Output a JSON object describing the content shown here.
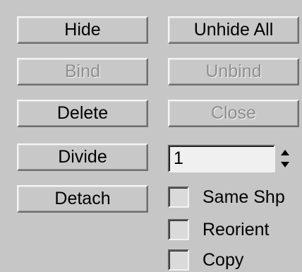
{
  "buttons": {
    "hide": "Hide",
    "unhide_all": "Unhide All",
    "bind": "Bind",
    "unbind": "Unbind",
    "delete": "Delete",
    "close": "Close",
    "divide": "Divide",
    "detach": "Detach"
  },
  "divide_count": {
    "value": "1"
  },
  "checkboxes": {
    "same_shp": {
      "label": "Same Shp",
      "checked": false
    },
    "reorient": {
      "label": "Reorient",
      "checked": false
    },
    "copy": {
      "label": "Copy",
      "checked": false
    }
  },
  "colors": {
    "panel_bg": "#c6c6c6",
    "disabled_text": "#8e8e8e",
    "field_bg": "#f0f0f0"
  }
}
